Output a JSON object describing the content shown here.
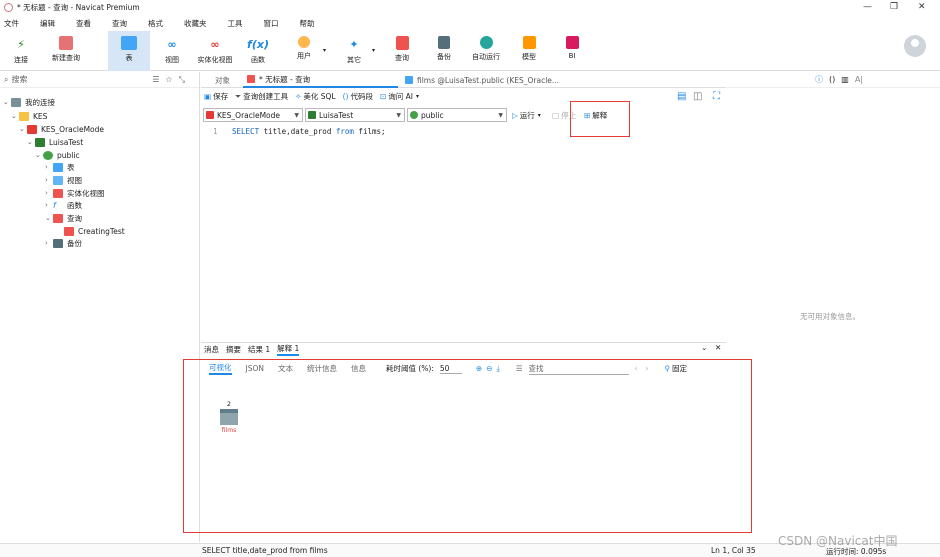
{
  "window": {
    "title": "* 无标题 - 查询 - Navicat Premium"
  },
  "menu": [
    "文件",
    "编辑",
    "查看",
    "查询",
    "格式",
    "收藏夹",
    "工具",
    "窗口",
    "帮助"
  ],
  "toolbar": [
    "连接",
    "新建查询",
    "表",
    "视图",
    "实体化视图",
    "函数",
    "用户",
    "其它",
    "查询",
    "备份",
    "自动运行",
    "模型",
    "BI"
  ],
  "sidebar": {
    "search_placeholder": "搜索",
    "tree": [
      {
        "label": "我的连接"
      },
      {
        "label": "KES"
      },
      {
        "label": "KES_OracleMode"
      },
      {
        "label": "LuisaTest"
      },
      {
        "label": "public"
      },
      {
        "label": "表"
      },
      {
        "label": "视图"
      },
      {
        "label": "实体化视图"
      },
      {
        "label": "函数"
      },
      {
        "label": "查询"
      },
      {
        "label": "CreatingTest"
      },
      {
        "label": "备份"
      }
    ]
  },
  "tabs": {
    "objects": "对象",
    "query": "* 无标题 - 查询",
    "films": "films @LuisaTest.public (KES_Oracle..."
  },
  "query_toolbar": {
    "save": "保存",
    "builder": "查询创建工具",
    "beautify": "美化 SQL",
    "snippet": "代码段",
    "ask_ai": "询问 AI"
  },
  "selectors": {
    "connection": "KES_OracleMode",
    "database": "LuisaTest",
    "schema": "public",
    "run": "运行",
    "stop": "停止",
    "explain": "解释"
  },
  "editor": {
    "line_no": "1",
    "kw1": "SELECT",
    "part1": " title,date_prod ",
    "kw2": "from",
    "part2": " films;"
  },
  "result_tabs": [
    "消息",
    "摘要",
    "结果 1",
    "解释 1"
  ],
  "explain_tabs": {
    "visual": "可视化",
    "json": "JSON",
    "text": "文本",
    "stats": "统计信息",
    "info": "信息",
    "threshold_label": "耗时阈值 (%):",
    "threshold_value": "50",
    "find_placeholder": "查找",
    "pin": "固定"
  },
  "plan_node": {
    "count": "2",
    "name": "films"
  },
  "right_panel": {
    "empty": "无可用对象信息。"
  },
  "status": {
    "sql": "SELECT title,date_prod from films",
    "pos": "Ln 1, Col 35",
    "runtime": "运行时间: 0.095s"
  },
  "watermark": "CSDN @Navicat中国",
  "colors": {
    "accent": "#1e88e5",
    "highlight": "#e53935",
    "active_tab_bg": "#d6e6f7"
  }
}
